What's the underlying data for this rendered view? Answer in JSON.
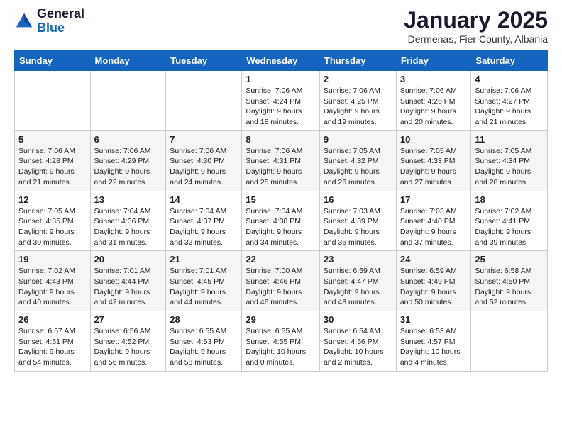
{
  "header": {
    "logo_general": "General",
    "logo_blue": "Blue",
    "month": "January 2025",
    "location": "Dermenas, Fier County, Albania"
  },
  "weekdays": [
    "Sunday",
    "Monday",
    "Tuesday",
    "Wednesday",
    "Thursday",
    "Friday",
    "Saturday"
  ],
  "weeks": [
    [
      {
        "day": "",
        "info": ""
      },
      {
        "day": "",
        "info": ""
      },
      {
        "day": "",
        "info": ""
      },
      {
        "day": "1",
        "info": "Sunrise: 7:06 AM\nSunset: 4:24 PM\nDaylight: 9 hours\nand 18 minutes."
      },
      {
        "day": "2",
        "info": "Sunrise: 7:06 AM\nSunset: 4:25 PM\nDaylight: 9 hours\nand 19 minutes."
      },
      {
        "day": "3",
        "info": "Sunrise: 7:06 AM\nSunset: 4:26 PM\nDaylight: 9 hours\nand 20 minutes."
      },
      {
        "day": "4",
        "info": "Sunrise: 7:06 AM\nSunset: 4:27 PM\nDaylight: 9 hours\nand 21 minutes."
      }
    ],
    [
      {
        "day": "5",
        "info": "Sunrise: 7:06 AM\nSunset: 4:28 PM\nDaylight: 9 hours\nand 21 minutes."
      },
      {
        "day": "6",
        "info": "Sunrise: 7:06 AM\nSunset: 4:29 PM\nDaylight: 9 hours\nand 22 minutes."
      },
      {
        "day": "7",
        "info": "Sunrise: 7:06 AM\nSunset: 4:30 PM\nDaylight: 9 hours\nand 24 minutes."
      },
      {
        "day": "8",
        "info": "Sunrise: 7:06 AM\nSunset: 4:31 PM\nDaylight: 9 hours\nand 25 minutes."
      },
      {
        "day": "9",
        "info": "Sunrise: 7:05 AM\nSunset: 4:32 PM\nDaylight: 9 hours\nand 26 minutes."
      },
      {
        "day": "10",
        "info": "Sunrise: 7:05 AM\nSunset: 4:33 PM\nDaylight: 9 hours\nand 27 minutes."
      },
      {
        "day": "11",
        "info": "Sunrise: 7:05 AM\nSunset: 4:34 PM\nDaylight: 9 hours\nand 28 minutes."
      }
    ],
    [
      {
        "day": "12",
        "info": "Sunrise: 7:05 AM\nSunset: 4:35 PM\nDaylight: 9 hours\nand 30 minutes."
      },
      {
        "day": "13",
        "info": "Sunrise: 7:04 AM\nSunset: 4:36 PM\nDaylight: 9 hours\nand 31 minutes."
      },
      {
        "day": "14",
        "info": "Sunrise: 7:04 AM\nSunset: 4:37 PM\nDaylight: 9 hours\nand 32 minutes."
      },
      {
        "day": "15",
        "info": "Sunrise: 7:04 AM\nSunset: 4:38 PM\nDaylight: 9 hours\nand 34 minutes."
      },
      {
        "day": "16",
        "info": "Sunrise: 7:03 AM\nSunset: 4:39 PM\nDaylight: 9 hours\nand 36 minutes."
      },
      {
        "day": "17",
        "info": "Sunrise: 7:03 AM\nSunset: 4:40 PM\nDaylight: 9 hours\nand 37 minutes."
      },
      {
        "day": "18",
        "info": "Sunrise: 7:02 AM\nSunset: 4:41 PM\nDaylight: 9 hours\nand 39 minutes."
      }
    ],
    [
      {
        "day": "19",
        "info": "Sunrise: 7:02 AM\nSunset: 4:43 PM\nDaylight: 9 hours\nand 40 minutes."
      },
      {
        "day": "20",
        "info": "Sunrise: 7:01 AM\nSunset: 4:44 PM\nDaylight: 9 hours\nand 42 minutes."
      },
      {
        "day": "21",
        "info": "Sunrise: 7:01 AM\nSunset: 4:45 PM\nDaylight: 9 hours\nand 44 minutes."
      },
      {
        "day": "22",
        "info": "Sunrise: 7:00 AM\nSunset: 4:46 PM\nDaylight: 9 hours\nand 46 minutes."
      },
      {
        "day": "23",
        "info": "Sunrise: 6:59 AM\nSunset: 4:47 PM\nDaylight: 9 hours\nand 48 minutes."
      },
      {
        "day": "24",
        "info": "Sunrise: 6:59 AM\nSunset: 4:49 PM\nDaylight: 9 hours\nand 50 minutes."
      },
      {
        "day": "25",
        "info": "Sunrise: 6:58 AM\nSunset: 4:50 PM\nDaylight: 9 hours\nand 52 minutes."
      }
    ],
    [
      {
        "day": "26",
        "info": "Sunrise: 6:57 AM\nSunset: 4:51 PM\nDaylight: 9 hours\nand 54 minutes."
      },
      {
        "day": "27",
        "info": "Sunrise: 6:56 AM\nSunset: 4:52 PM\nDaylight: 9 hours\nand 56 minutes."
      },
      {
        "day": "28",
        "info": "Sunrise: 6:55 AM\nSunset: 4:53 PM\nDaylight: 9 hours\nand 58 minutes."
      },
      {
        "day": "29",
        "info": "Sunrise: 6:55 AM\nSunset: 4:55 PM\nDaylight: 10 hours\nand 0 minutes."
      },
      {
        "day": "30",
        "info": "Sunrise: 6:54 AM\nSunset: 4:56 PM\nDaylight: 10 hours\nand 2 minutes."
      },
      {
        "day": "31",
        "info": "Sunrise: 6:53 AM\nSunset: 4:57 PM\nDaylight: 10 hours\nand 4 minutes."
      },
      {
        "day": "",
        "info": ""
      }
    ]
  ]
}
